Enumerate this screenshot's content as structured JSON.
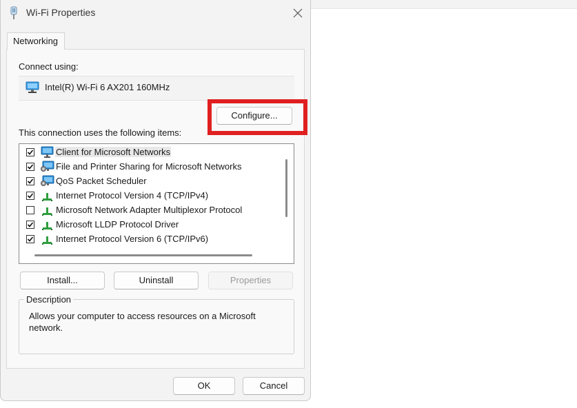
{
  "window": {
    "title": "Wi-Fi Properties",
    "close_label": "Close"
  },
  "tabs": [
    {
      "label": "Networking"
    }
  ],
  "networking": {
    "connect_using_label": "Connect using:",
    "adapter_name": "Intel(R) Wi-Fi 6 AX201 160MHz",
    "configure_button": "Configure...",
    "items_label": "This connection uses the following items:",
    "items": [
      {
        "label": "Client for Microsoft Networks",
        "checked": true,
        "icon": "network-client-icon",
        "selected": true
      },
      {
        "label": "File and Printer Sharing for Microsoft Networks",
        "checked": true,
        "icon": "network-service-icon",
        "selected": false
      },
      {
        "label": "QoS Packet Scheduler",
        "checked": true,
        "icon": "network-service-icon",
        "selected": false
      },
      {
        "label": "Internet Protocol Version 4 (TCP/IPv4)",
        "checked": true,
        "icon": "protocol-icon",
        "selected": false
      },
      {
        "label": "Microsoft Network Adapter Multiplexor Protocol",
        "checked": false,
        "icon": "protocol-icon",
        "selected": false
      },
      {
        "label": "Microsoft LLDP Protocol Driver",
        "checked": true,
        "icon": "protocol-icon",
        "selected": false
      },
      {
        "label": "Internet Protocol Version 6 (TCP/IPv6)",
        "checked": true,
        "icon": "protocol-icon",
        "selected": false
      }
    ],
    "buttons": {
      "install": "Install...",
      "uninstall": "Uninstall",
      "properties": "Properties"
    },
    "description": {
      "title": "Description",
      "text": "Allows your computer to access resources on a Microsoft network."
    }
  },
  "footer": {
    "ok": "OK",
    "cancel": "Cancel"
  },
  "colors": {
    "highlight_border": "#e02020",
    "protocol_green": "#2e9e3e",
    "monitor_blue": "#2f8fd8"
  }
}
